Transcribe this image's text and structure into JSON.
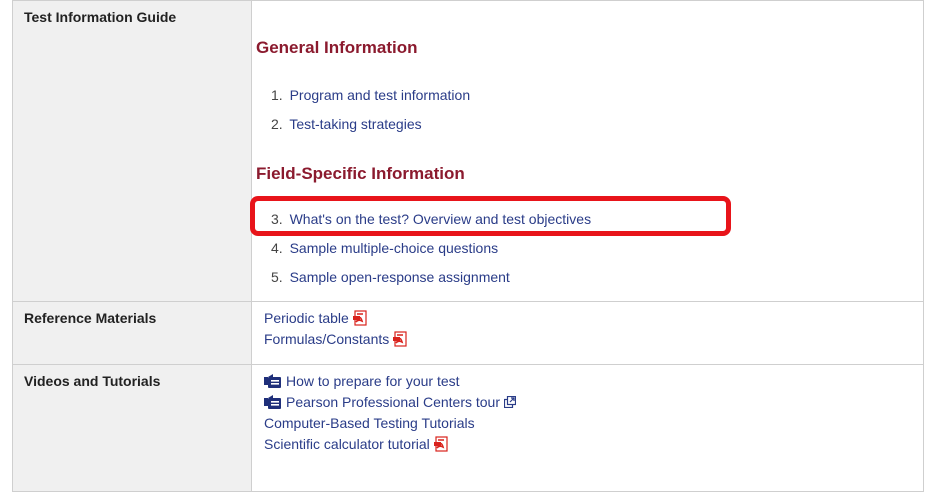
{
  "guide": {
    "label": "Test Information Guide",
    "general_heading": "General Information",
    "general_items": [
      {
        "num": "1.",
        "text": "Program and test information"
      },
      {
        "num": "2.",
        "text": "Test-taking strategies"
      }
    ],
    "field_heading": "Field-Specific Information",
    "field_items": [
      {
        "num": "3.",
        "text": "What's on the test? Overview and test objectives"
      },
      {
        "num": "4.",
        "text": "Sample multiple-choice questions"
      },
      {
        "num": "5.",
        "text": "Sample open-response assignment"
      }
    ]
  },
  "reference": {
    "label": "Reference Materials",
    "links": [
      {
        "text": "Periodic table",
        "icon": "pdf-icon"
      },
      {
        "text": "Formulas/Constants",
        "icon": "pdf-icon"
      }
    ]
  },
  "videos": {
    "label": "Videos and Tutorials",
    "links": [
      {
        "text": "How to prepare for your test",
        "icon": "video-icon"
      },
      {
        "text": "Pearson Professional Centers tour",
        "icon": "video-icon",
        "trailing_icon": "external-link-icon"
      },
      {
        "text": "Computer-Based Testing Tutorials"
      },
      {
        "text": "Scientific calculator tutorial",
        "icon": "pdf-icon"
      }
    ]
  },
  "colors": {
    "link": "#2a3c88",
    "heading": "#8b1a2e",
    "label_bg": "#f0f0f0",
    "highlight": "#e8141a",
    "pdf_red": "#d9221c"
  }
}
